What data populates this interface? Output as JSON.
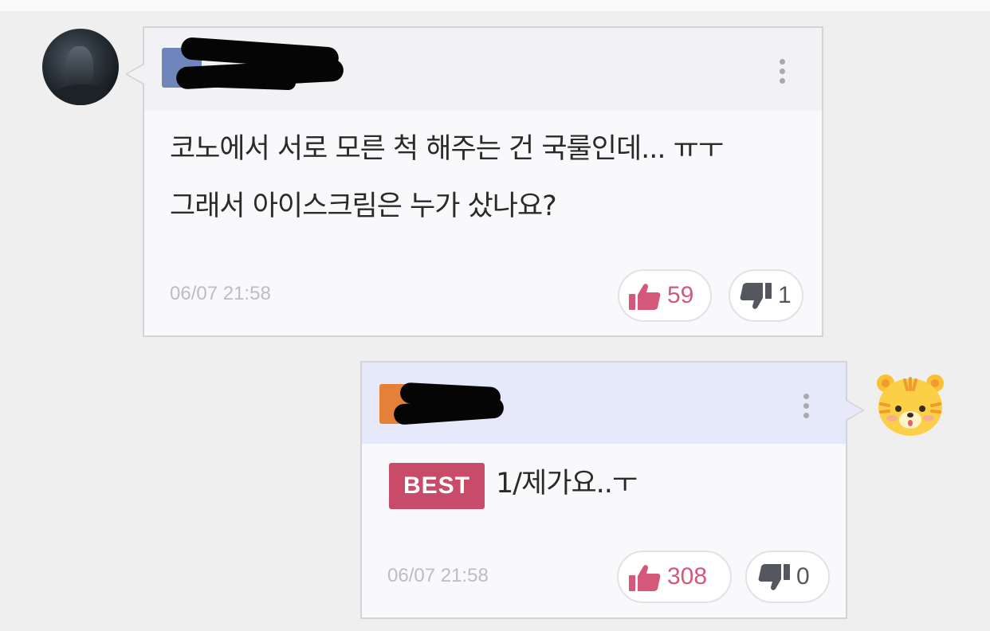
{
  "comments": [
    {
      "text_lines": [
        "코노에서 서로 모른 척 해주는 건 국룰인데... ㅠㅜ",
        "그래서 아이스크림은 누가 샀나요?"
      ],
      "timestamp": "06/07 21:58",
      "likes": "59",
      "dislikes": "1",
      "avatar": "user-photo-avatar",
      "colors": {
        "badge": "#6f86bd",
        "header": "#f2f2f4"
      }
    },
    {
      "best_label": "BEST",
      "text": "1/제가요..ㅜ",
      "timestamp": "06/07 21:58",
      "likes": "308",
      "dislikes": "0",
      "avatar": "tiger-avatar",
      "colors": {
        "badge": "#e58039",
        "header": "#e5e9fa",
        "best": "#c94b6a"
      }
    }
  ],
  "icons": {
    "like": "thumbs-up-icon",
    "dislike": "thumbs-down-icon",
    "more": "more-vertical-icon"
  },
  "colors": {
    "like": "#d4587a",
    "dislike": "#55575e",
    "timestamp": "#bdbdc2",
    "background": "#efefef"
  }
}
